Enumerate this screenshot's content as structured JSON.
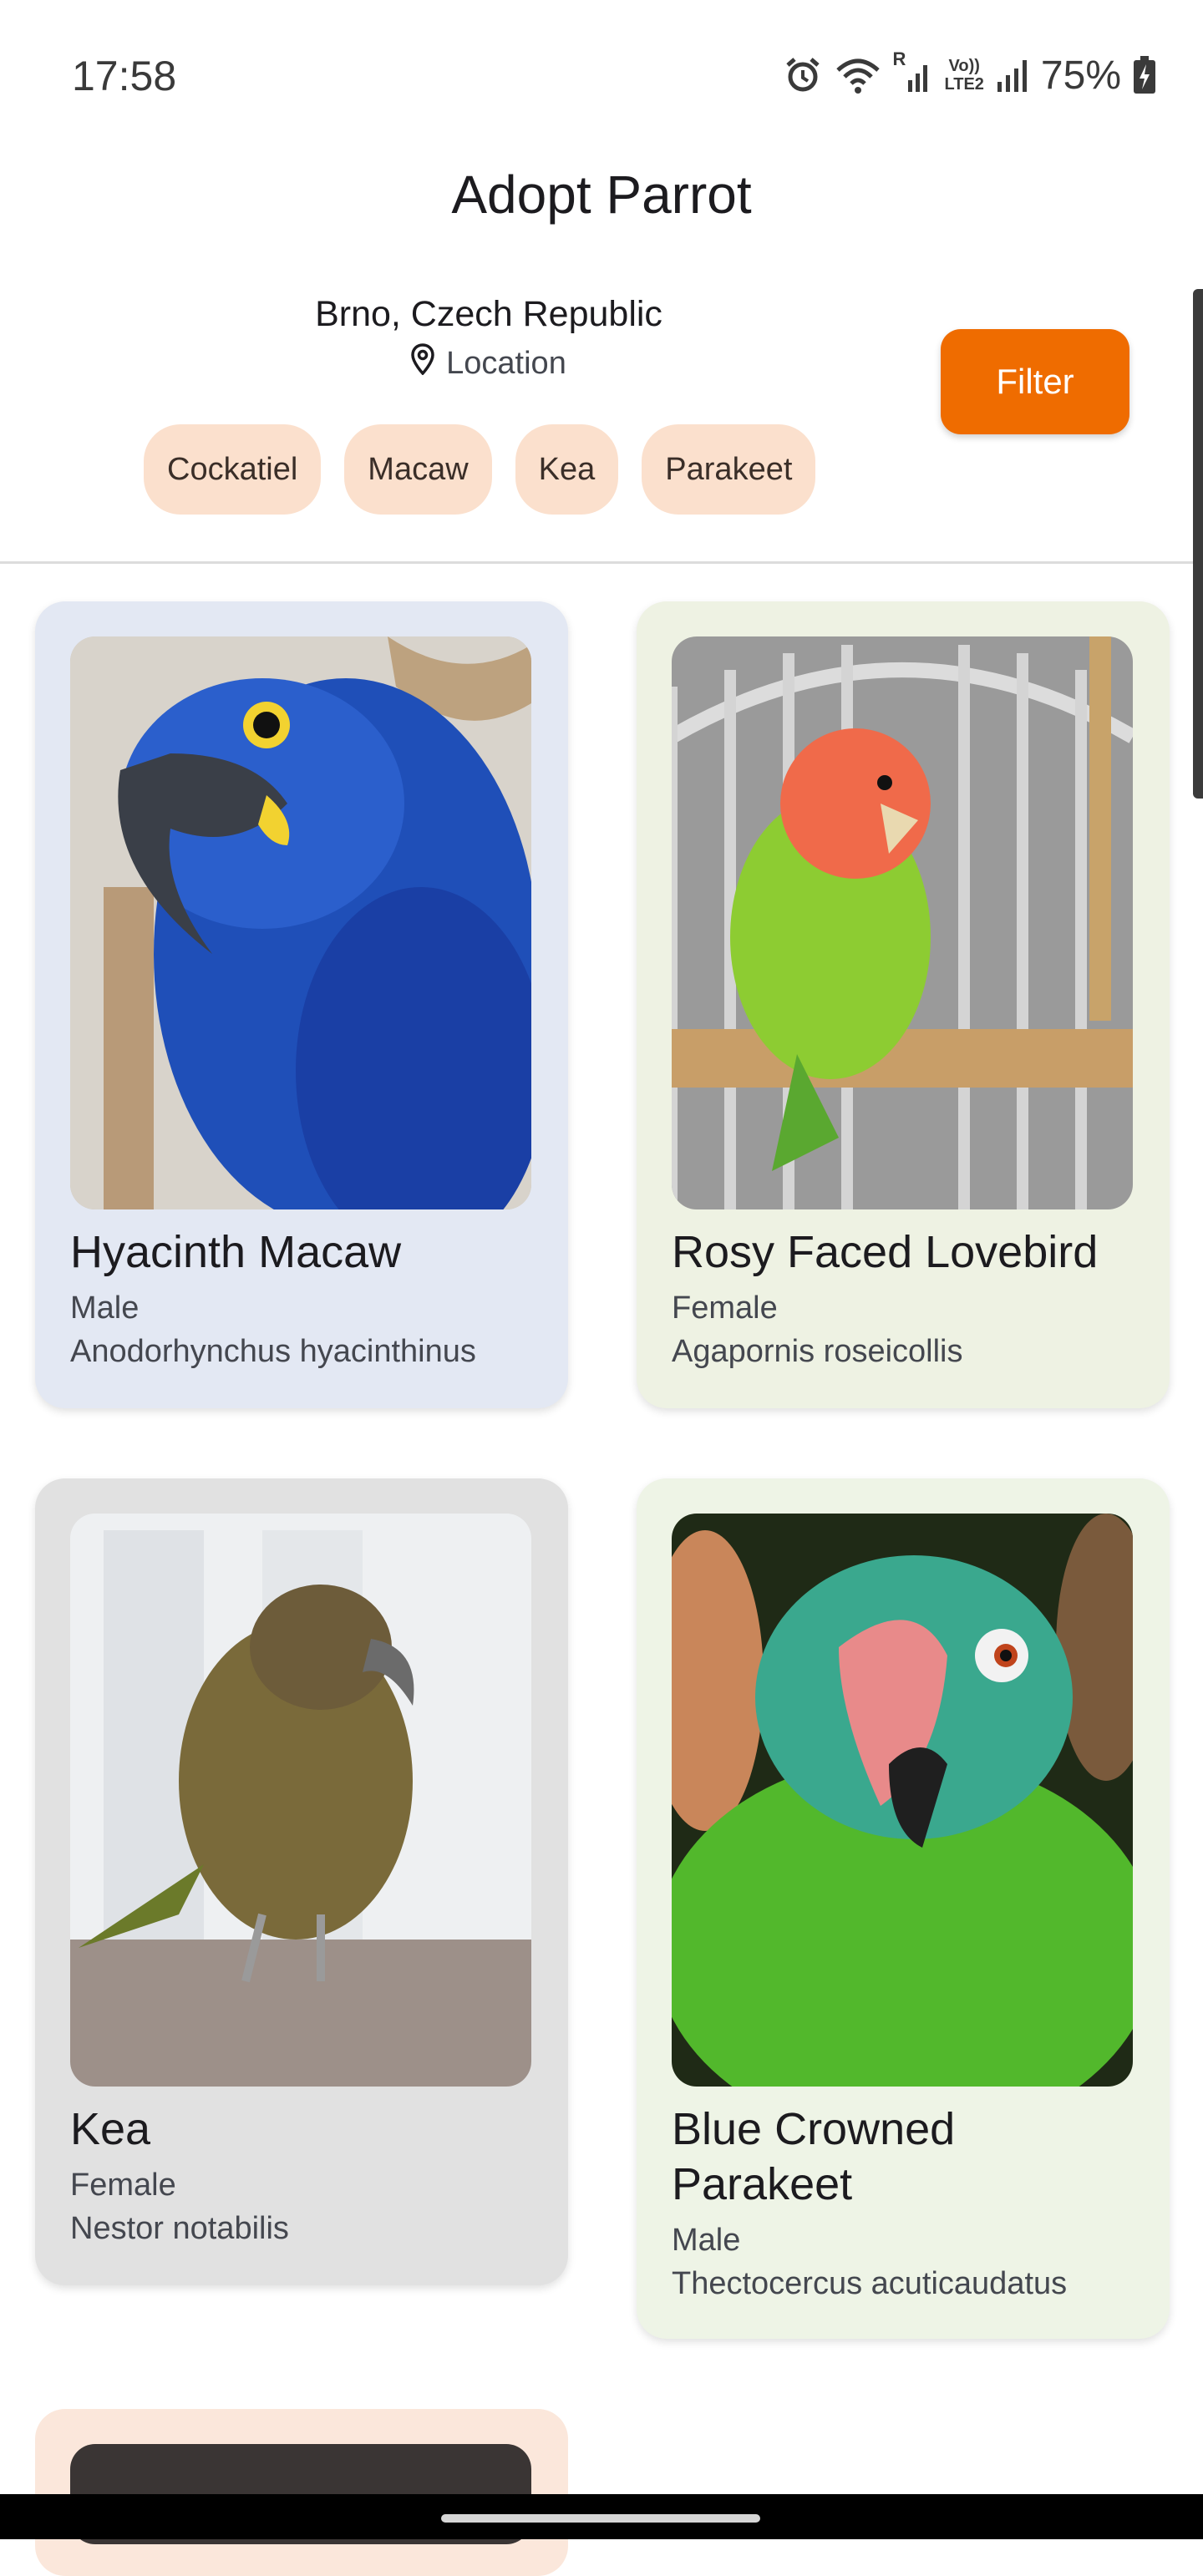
{
  "status_bar": {
    "time": "17:58",
    "battery": "75%",
    "icons": [
      "alarm-icon",
      "wifi-icon",
      "signal-roaming-icon",
      "volte-lte2-icon",
      "signal-icon",
      "battery-charging-icon"
    ],
    "roaming_label": "R",
    "volte_label_1": "Vo))",
    "volte_label_2": "LTE2"
  },
  "header": {
    "title": "Adopt Parrot"
  },
  "location": {
    "city": "Brno, Czech Republic",
    "label": "Location",
    "icon": "location-pin-icon"
  },
  "filter_button": {
    "label": "Filter",
    "color": "#ef6c00"
  },
  "chips": [
    {
      "label": "Cockatiel"
    },
    {
      "label": "Macaw"
    },
    {
      "label": "Kea"
    },
    {
      "label": "Parakeet"
    }
  ],
  "cards": [
    {
      "name": "Hyacinth Macaw",
      "sex": "Male",
      "species": "Anodorhynchus hyacinthinus",
      "bg": "#e3e8f3"
    },
    {
      "name": "Rosy Faced Lovebird",
      "sex": "Female",
      "species": "Agapornis roseicollis",
      "bg": "#eef2e3"
    },
    {
      "name": "Kea",
      "sex": "Female",
      "species": "Nestor notabilis",
      "bg": "#e1e1e1"
    },
    {
      "name": "Blue Crowned Parakeet",
      "sex": "Male",
      "species": "Thectocercus acuticaudatus",
      "bg": "#eef4e6"
    }
  ],
  "partial_card": {
    "bg": "#fbe7db"
  }
}
